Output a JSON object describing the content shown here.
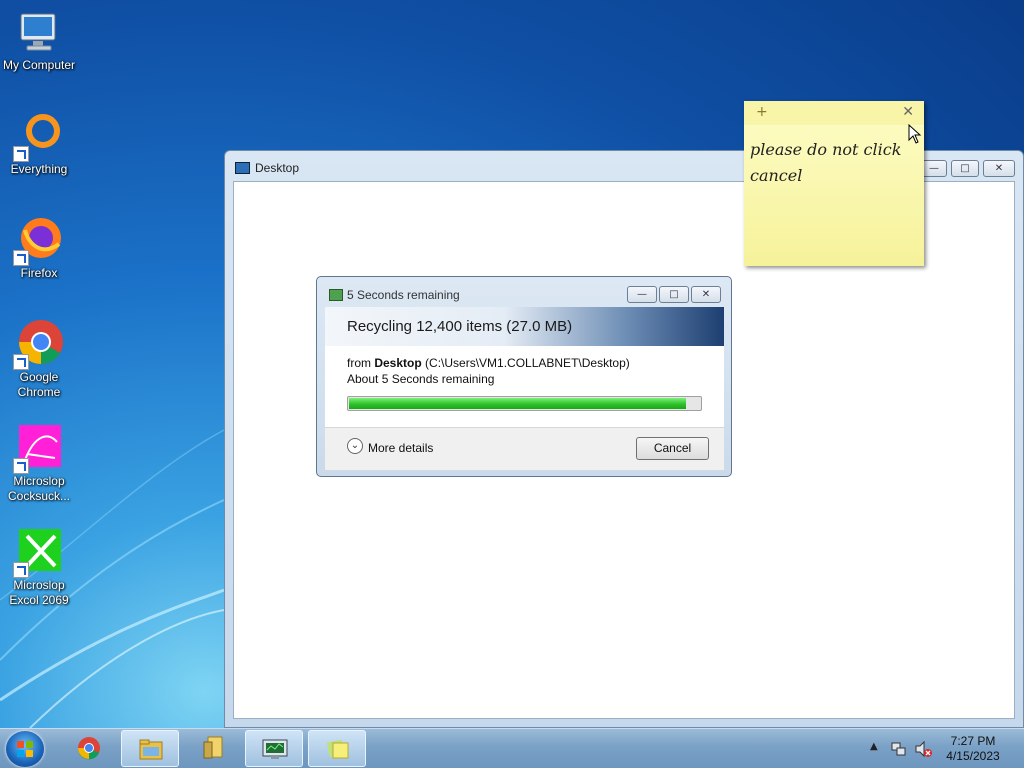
{
  "desktop_icons": [
    {
      "label": "My Computer",
      "icon": "computer-icon"
    },
    {
      "label": "Everything",
      "icon": "everything-icon"
    },
    {
      "label": "Firefox",
      "icon": "firefox-icon"
    },
    {
      "label": "Google Chrome",
      "icon": "chrome-icon"
    },
    {
      "label": "Microslop Cocksuck...",
      "icon": "pink-app-icon"
    },
    {
      "label": "Microslop Excol 2069",
      "icon": "green-app-icon"
    }
  ],
  "explorer_window": {
    "title": "Desktop"
  },
  "sticky_note": {
    "text": "please do not click cancel",
    "add_glyph": "+",
    "close_glyph": "✕"
  },
  "dialog": {
    "title": "5 Seconds remaining",
    "header": "Recycling 12,400 items (27.0 MB)",
    "from_prefix": "from",
    "from_location": "Desktop",
    "from_path": "(C:\\Users\\VM1.COLLABNET\\Desktop)",
    "time_remaining": "About 5 Seconds remaining",
    "progress": 0.96,
    "more_details": "More details",
    "cancel_label": "Cancel"
  },
  "taskbar": {
    "items": [
      {
        "name": "chrome",
        "active": false
      },
      {
        "name": "file-explorer",
        "active": true
      },
      {
        "name": "sticky-app",
        "active": false
      },
      {
        "name": "system-monitor",
        "active": false
      },
      {
        "name": "sticky-notes",
        "active": false
      }
    ],
    "time": "7:27 PM",
    "date": "4/15/2023"
  },
  "colors": {
    "accent": "#1a64b8",
    "progress_fill": "#2ec22a",
    "sticky": "#f8f4a8"
  }
}
